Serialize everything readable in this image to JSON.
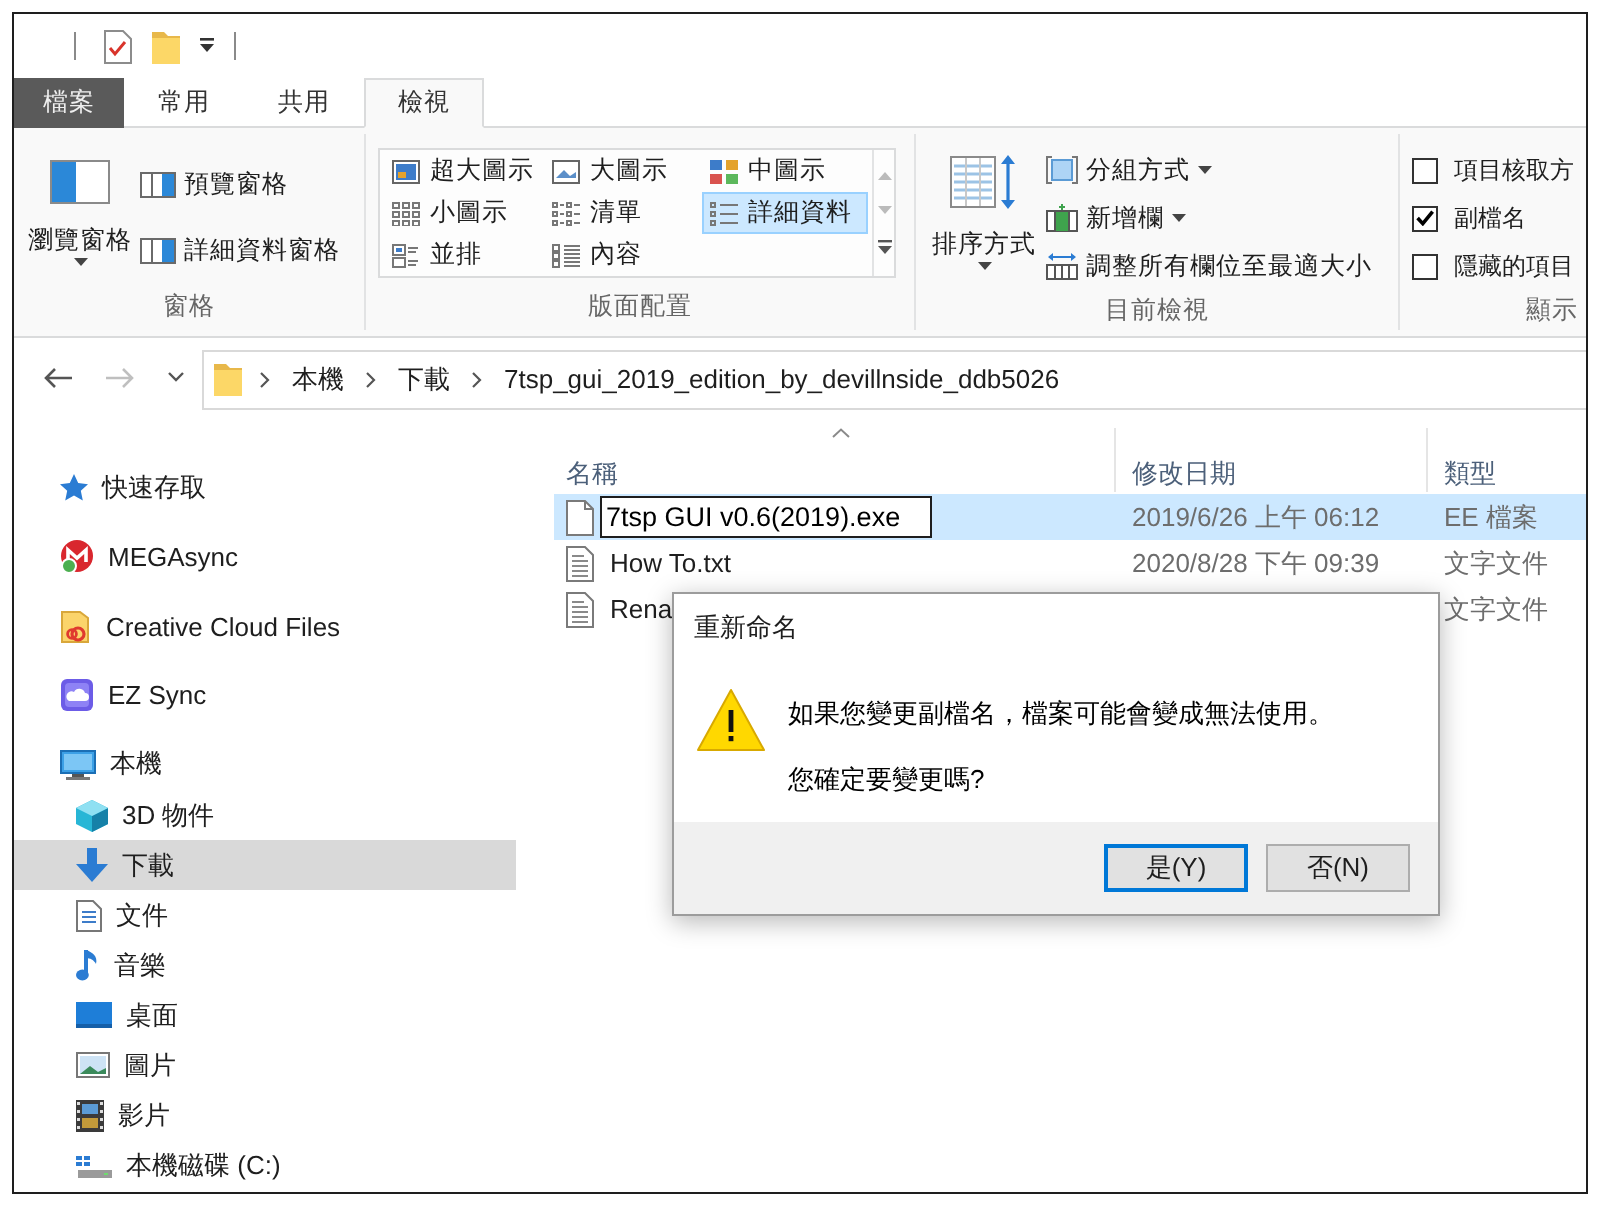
{
  "ribbon": {
    "tabs": [
      {
        "label": "檔案",
        "kind": "file",
        "selected": false
      },
      {
        "label": "常用",
        "kind": "tab",
        "selected": false
      },
      {
        "label": "共用",
        "kind": "tab",
        "selected": false
      },
      {
        "label": "檢視",
        "kind": "tab",
        "selected": true
      }
    ],
    "panes": {
      "label": "窗格",
      "large_button": "瀏覽窗格",
      "buttons": [
        "預覽窗格",
        "詳細資料窗格"
      ]
    },
    "layout": {
      "label": "版面配置",
      "options": [
        {
          "label": "超大圖示",
          "selected": false
        },
        {
          "label": "大圖示",
          "selected": false
        },
        {
          "label": "中圖示",
          "selected": false
        },
        {
          "label": "小圖示",
          "selected": false
        },
        {
          "label": "清單",
          "selected": false
        },
        {
          "label": "詳細資料",
          "selected": true
        },
        {
          "label": "並排",
          "selected": false
        },
        {
          "label": "內容",
          "selected": false
        }
      ]
    },
    "current_view": {
      "label": "目前檢視",
      "large_button": "排序方式",
      "buttons": [
        {
          "label": "分組方式",
          "dropdown": true
        },
        {
          "label": "新增欄",
          "dropdown": true
        },
        {
          "label": "調整所有欄位至最適大小",
          "dropdown": false
        }
      ]
    },
    "show_hide": {
      "label": "顯示",
      "checkboxes": [
        {
          "label": "項目核取方",
          "checked": false
        },
        {
          "label": "副檔名",
          "checked": true
        },
        {
          "label": "隱藏的項目",
          "checked": false
        }
      ]
    }
  },
  "address_bar": {
    "nav_buttons": [
      {
        "kind": "back",
        "disabled": false
      },
      {
        "kind": "forward",
        "disabled": true
      },
      {
        "kind": "recent",
        "disabled": false
      }
    ],
    "path": [
      "本機",
      "下載",
      "7tsp_gui_2019_edition_by_devillnside_ddb5026"
    ]
  },
  "navigation_pane": {
    "items": [
      {
        "label": "快速存取",
        "selected": false
      },
      {
        "label": "MEGAsync",
        "selected": false
      },
      {
        "label": "Creative Cloud Files",
        "selected": false
      },
      {
        "label": "EZ Sync",
        "selected": false
      },
      {
        "label": "本機",
        "selected": false,
        "children": [
          {
            "label": "3D 物件",
            "selected": false
          },
          {
            "label": "下載",
            "selected": true
          },
          {
            "label": "文件",
            "selected": false
          },
          {
            "label": "音樂",
            "selected": false
          },
          {
            "label": "桌面",
            "selected": false
          },
          {
            "label": "圖片",
            "selected": false
          },
          {
            "label": "影片",
            "selected": false
          },
          {
            "label": "本機磁碟 (C:)",
            "selected": false
          }
        ]
      }
    ]
  },
  "file_list": {
    "columns": [
      {
        "label": "名稱",
        "sorted": true
      },
      {
        "label": "修改日期",
        "sorted": false
      },
      {
        "label": "類型",
        "sorted": false
      }
    ],
    "rows": [
      {
        "kind": "program",
        "name": "7tsp GUI v0.6(2019).exe",
        "modified": "2019/6/26 上午 06:12",
        "type": "EE 檔案",
        "selected": true,
        "renaming": true
      },
      {
        "kind": "text",
        "name": "How To.txt",
        "modified": "2020/8/28 下午 09:39",
        "type": "文字文件",
        "selected": false,
        "renaming": false
      },
      {
        "kind": "text",
        "name": "Rena",
        "type": "文字文件",
        "selected": false,
        "renaming": false
      }
    ]
  },
  "dialog": {
    "title": "重新命名",
    "messages": [
      "如果您變更副檔名，檔案可能會變成無法使用。",
      "您確定要變更嗎?"
    ],
    "buttons": [
      {
        "label": "是(Y)",
        "default": true
      },
      {
        "label": "否(N)",
        "default": false
      }
    ]
  }
}
